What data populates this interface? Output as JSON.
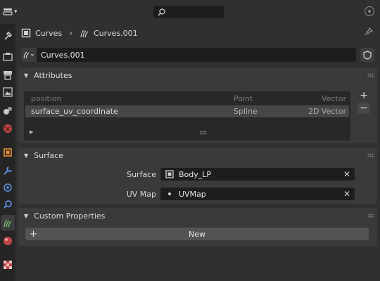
{
  "header": {
    "editor_type_icon": "properties-editor-icon",
    "search_icon": "search-icon",
    "collapse_icon": "chevron-down-circle-icon"
  },
  "tabs": [
    {
      "name": "tool-tab",
      "icon": "tool-icon"
    },
    {
      "name": "render-tab",
      "icon": "render-icon"
    },
    {
      "name": "output-tab",
      "icon": "output-icon"
    },
    {
      "name": "view-layer-tab",
      "icon": "view-layer-icon"
    },
    {
      "name": "scene-tab",
      "icon": "scene-icon"
    },
    {
      "name": "world-tab",
      "icon": "world-icon"
    },
    {
      "name": "object-tab",
      "icon": "object-icon"
    },
    {
      "name": "modifiers-tab",
      "icon": "wrench-icon"
    },
    {
      "name": "physics-tab",
      "icon": "physics-icon"
    },
    {
      "name": "constraints-tab",
      "icon": "constraints-icon"
    },
    {
      "name": "data-tab",
      "icon": "curves-data-icon",
      "active": true
    },
    {
      "name": "material-tab",
      "icon": "material-icon"
    },
    {
      "name": "texture-tab",
      "icon": "texture-icon"
    }
  ],
  "breadcrumb": {
    "object": "Curves",
    "data": "Curves.001"
  },
  "datablock": {
    "name": "Curves.001"
  },
  "attributes": {
    "title": "Attributes",
    "rows": [
      {
        "name": "position",
        "domain": "Point",
        "type": "Vector",
        "dim": true
      },
      {
        "name": "surface_uv_coordinate",
        "domain": "Spline",
        "type": "2D Vector",
        "selected": true
      }
    ],
    "add_label": "+",
    "remove_label": "−"
  },
  "surface": {
    "title": "Surface",
    "surface_label": "Surface",
    "surface_value": "Body_LP",
    "uvmap_label": "UV Map",
    "uvmap_value": "UVMap"
  },
  "custom_properties": {
    "title": "Custom Properties",
    "new_label": "New"
  },
  "colors": {
    "background": "#303030",
    "panel": "#3a3a3a",
    "field": "#1d1d1d",
    "accent_green": "#7ac47a"
  }
}
